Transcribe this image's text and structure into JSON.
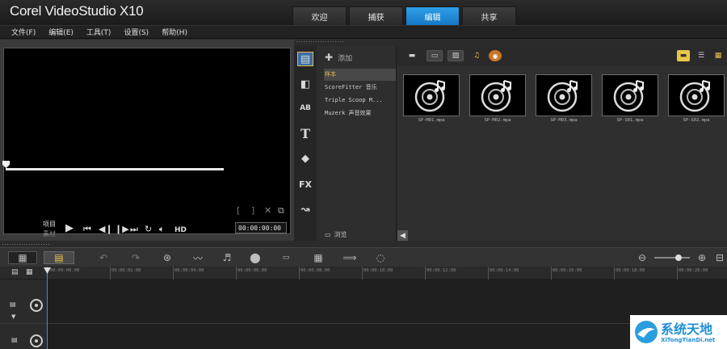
{
  "app": {
    "title": "Corel VideoStudio X10"
  },
  "tabs": [
    {
      "label": "欢迎",
      "active": false
    },
    {
      "label": "捕获",
      "active": false
    },
    {
      "label": "编辑",
      "active": true
    },
    {
      "label": "共享",
      "active": false
    }
  ],
  "menu": [
    "文件(F)",
    "编辑(E)",
    "工具(T)",
    "设置(S)",
    "帮助(H)"
  ],
  "player": {
    "mode_project": "项目",
    "mode_clip": "素材",
    "hd_label": "HD",
    "timecode": "00:00:00:00"
  },
  "library": {
    "add_label": "添加",
    "browse_label": "浏览",
    "tree": [
      {
        "label": "样本",
        "selected": true
      },
      {
        "label": "ScoreFitter 音乐",
        "selected": false
      },
      {
        "label": "Triple Scoop M...",
        "selected": false
      },
      {
        "label": "Muzerk 声音效果",
        "selected": false
      }
    ],
    "clips": [
      {
        "name": "SP-M01.mpa"
      },
      {
        "name": "SP-M02.mpa"
      },
      {
        "name": "SP-M03.mpa"
      },
      {
        "name": "SP-S01.mpa"
      },
      {
        "name": "SP-S02.mpa"
      }
    ]
  },
  "timeline": {
    "ticks": [
      "00:00:00:00",
      "00:00:02:00",
      "00:00:04:00",
      "00:00:06:00",
      "00:00:08:00",
      "00:00:10:00",
      "00:00:12:00",
      "00:00:14:00",
      "00:00:16:00",
      "00:00:18:00",
      "00:00:20:00"
    ]
  },
  "watermark": {
    "title": "系统天地",
    "subtitle": "XiTongTianDi.net"
  },
  "colors": {
    "accent": "#1f8ddb",
    "selected_folder": "#e8b84a"
  }
}
